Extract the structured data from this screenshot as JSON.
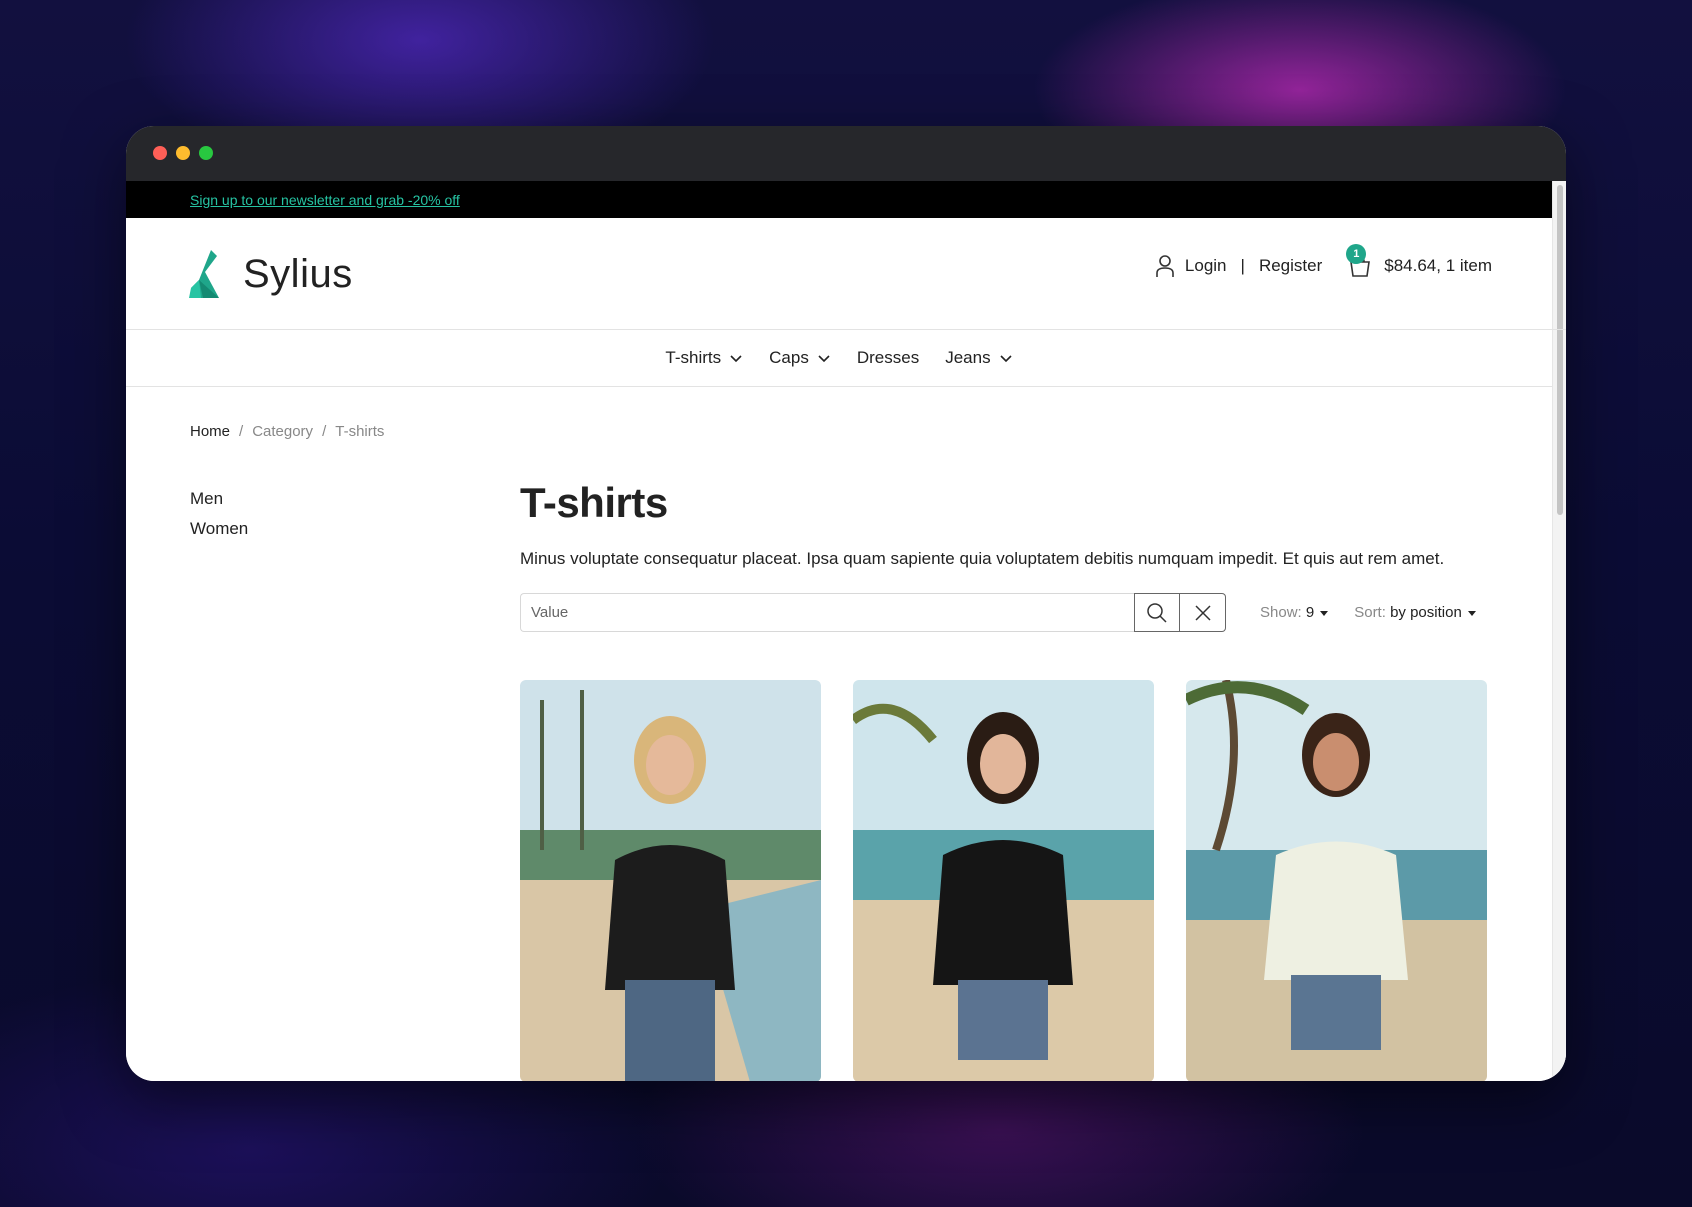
{
  "promo": {
    "text": "Sign up to our newsletter and grab -20% off"
  },
  "brand": {
    "name": "Sylius",
    "accent": "#1fa68a"
  },
  "account": {
    "login": "Login",
    "separator": "|",
    "register": "Register"
  },
  "cart": {
    "count": "1",
    "total": "$84.64, 1 item"
  },
  "nav": {
    "items": [
      {
        "label": "T-shirts",
        "has_dropdown": true
      },
      {
        "label": "Caps",
        "has_dropdown": true
      },
      {
        "label": "Dresses",
        "has_dropdown": false
      },
      {
        "label": "Jeans",
        "has_dropdown": true
      }
    ]
  },
  "breadcrumb": {
    "home": "Home",
    "category": "Category",
    "current": "T-shirts",
    "separator": "/"
  },
  "sidebar": {
    "items": [
      "Men",
      "Women"
    ]
  },
  "main": {
    "title": "T-shirts",
    "description": "Minus voluptate consequatur placeat. Ipsa quam sapiente quia voluptatem debitis numquam impedit. Et quis aut rem amet.",
    "search_placeholder": "Value",
    "show_label": "Show:",
    "show_value": "9",
    "sort_label": "Sort:",
    "sort_value": "by position"
  },
  "products": [
    {
      "shirt_color": "#1c1c1c",
      "hair_color": "#d9b67a"
    },
    {
      "shirt_color": "#151515",
      "hair_color": "#2a1c14"
    },
    {
      "shirt_color": "#eef0e2",
      "hair_color": "#3a2418"
    }
  ]
}
